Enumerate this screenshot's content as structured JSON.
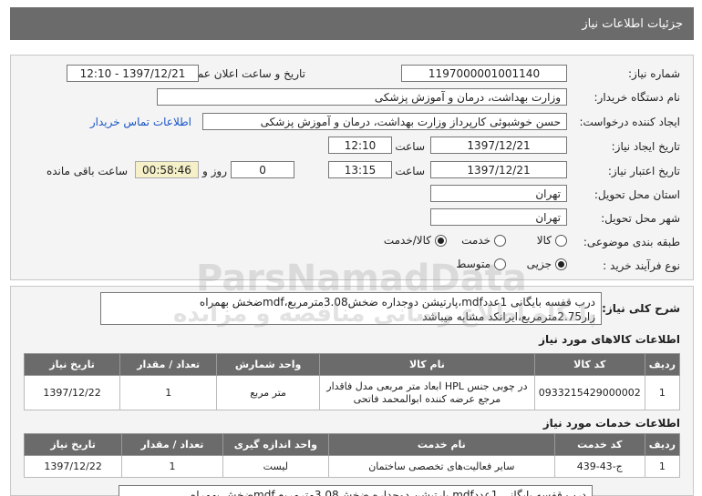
{
  "header": {
    "title": "جزئیات اطلاعات نیاز"
  },
  "form": {
    "need_number_label": "شماره نیاز:",
    "need_number": "1197000001001140",
    "announce_label": "تاریخ و ساعت اعلان عمومی:",
    "announce_value": "1397/12/21 - 12:10",
    "buyer_label": "نام دستگاه خریدار:",
    "buyer_value": "وزارت بهداشت، درمان و آموزش پزشکی",
    "creator_label": "ایجاد کننده درخواست:",
    "creator_value": "حسن خوشبوئی کارپرداز وزارت بهداشت، درمان و آموزش پزشکی",
    "contact_link": "اطلاعات تماس خریدار",
    "created_date_label": "تاریخ ایجاد نیاز:",
    "created_date": "1397/12/21",
    "time_label": "ساعت",
    "created_time": "12:10",
    "validity_label": "تاریخ اعتبار نیاز:",
    "validity_date": "1397/12/21",
    "validity_time": "13:15",
    "days_value": "0",
    "days_label": "روز و",
    "remaining_time": "00:58:46",
    "remaining_label": "ساعت باقی مانده",
    "province_label": "استان محل تحویل:",
    "province_value": "تهران",
    "city_label": "شهر محل تحویل:",
    "city_value": "تهران",
    "category_label": "طبقه بندی موضوعی:",
    "category_options": [
      "کالا",
      "خدمت",
      "کالا/خدمت"
    ],
    "process_label": "نوع فرآیند خرید :",
    "process_options": [
      "جزیی",
      "متوسط"
    ]
  },
  "description": {
    "label": "شرح کلی نیاز:",
    "text": "درب قفسه بایگانی 1عددmdf،پارتیشن دوجداره ضخش3.08مترمربع،mdfضخش بهمراه زار2.75مترمربع،ایرانکد مشابه میباشد"
  },
  "goods": {
    "title": "اطلاعات کالاهای مورد نیاز",
    "headers": [
      "ردیف",
      "کد کالا",
      "نام کالا",
      "واحد شمارش",
      "تعداد / مقدار",
      "تاریخ نیاز"
    ],
    "rows": [
      [
        "1",
        "0933215429000002",
        "در چوبی جنس HPL ابعاد متر مربعی مدل فاقدار مرجع عرضه کننده ابوالمحمد فاتحی",
        "متر مربع",
        "1",
        "1397/12/22"
      ]
    ]
  },
  "services": {
    "title": "اطلاعات خدمات مورد نیاز",
    "headers": [
      "ردیف",
      "کد خدمت",
      "نام خدمت",
      "واحد اندازه گیری",
      "تعداد / مقدار",
      "تاریخ نیاز"
    ],
    "rows": [
      [
        "1",
        "ج-43-439",
        "سایر فعالیت‌های تخصصی ساختمان",
        "لیست",
        "1",
        "1397/12/22"
      ]
    ]
  },
  "footer_description": "درب قفسه بایگانی 1عددmdf،پارتیشن دوجداره ضخش3.08مترمربع،mdfضخش بهمراه",
  "watermark": {
    "en": "ParsNamadData",
    "fa": "پایگاه اطلاع رسانی مناقصه و مزایده"
  }
}
